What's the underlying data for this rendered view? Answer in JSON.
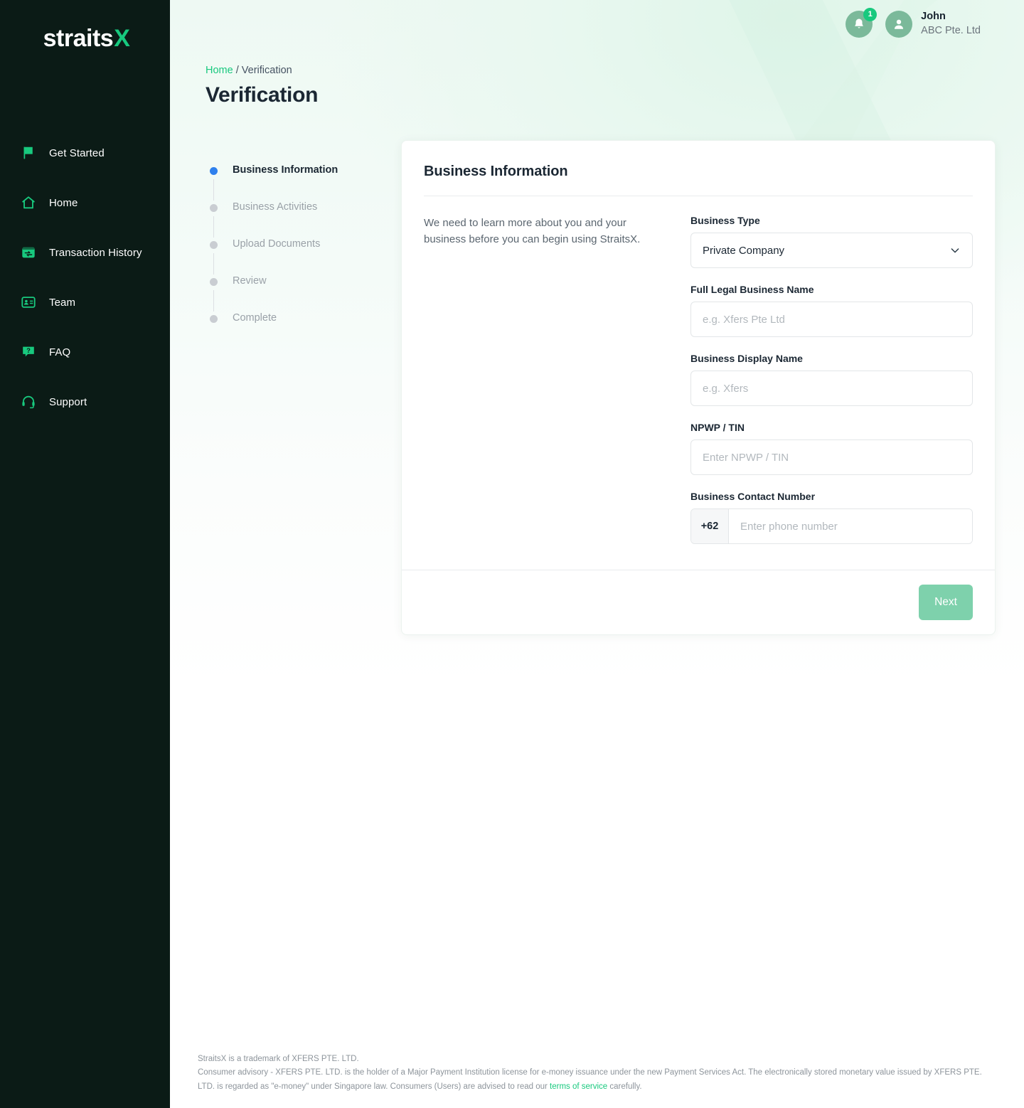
{
  "brand": {
    "logo_text": "straits",
    "logo_accent": "X",
    "accent_color": "#18C97E",
    "sidebar_bg": "#0B1B16"
  },
  "sidebar": {
    "items": [
      {
        "label": "Get Started",
        "icon": "flag-icon"
      },
      {
        "label": "Home",
        "icon": "home-icon"
      },
      {
        "label": "Transaction History",
        "icon": "transaction-history-icon"
      },
      {
        "label": "Team",
        "icon": "team-icon"
      },
      {
        "label": "FAQ",
        "icon": "faq-icon"
      },
      {
        "label": "Support",
        "icon": "support-headset-icon"
      }
    ]
  },
  "topbar": {
    "notification_count": "1",
    "bell_icon": "bell-icon",
    "avatar_icon": "user-avatar-icon",
    "user_name": "John",
    "user_org": "ABC Pte. Ltd"
  },
  "breadcrumb": {
    "home": "Home",
    "separator": "/",
    "current": "Verification"
  },
  "page": {
    "title": "Verification"
  },
  "stepper": {
    "steps": [
      {
        "label": "Business Information",
        "state": "active"
      },
      {
        "label": "Business Activities",
        "state": "inactive"
      },
      {
        "label": "Upload Documents",
        "state": "inactive"
      },
      {
        "label": "Review",
        "state": "inactive"
      },
      {
        "label": "Complete",
        "state": "inactive"
      }
    ],
    "active_dot_color": "#2f80ed",
    "inactive_dot_color": "#c9cdd2"
  },
  "card": {
    "title": "Business Information",
    "intro": "We need to learn more about you and your business before you can begin using StraitsX.",
    "fields": {
      "business_type": {
        "label": "Business Type",
        "value": "Private Company",
        "chevron_icon": "chevron-down-icon"
      },
      "full_legal_business_name": {
        "label": "Full Legal Business Name",
        "placeholder": "e.g. Xfers Pte Ltd",
        "value": ""
      },
      "business_display_name": {
        "label": "Business Display Name",
        "placeholder": "e.g. Xfers",
        "value": ""
      },
      "npwp_tin": {
        "label": "NPWP / TIN",
        "placeholder": "Enter NPWP / TIN",
        "value": ""
      },
      "business_contact_number": {
        "label": "Business Contact Number",
        "country_code": "+62",
        "placeholder": "Enter phone number",
        "value": ""
      }
    },
    "next_label": "Next",
    "next_color": "#7ed1ac"
  },
  "footer": {
    "line1": "StraitsX is a trademark of XFERS PTE. LTD.",
    "line2_a": "Consumer advisory - XFERS PTE. LTD. is the holder of a Major Payment Institution license for e-money issuance under the new Payment Services Act. The electronically stored monetary value issued by XFERS PTE. LTD. is regarded as \"e-money\" under Singapore law. Consumers (Users) are advised to read our ",
    "terms_link": "terms of service",
    "line2_b": " carefully."
  }
}
